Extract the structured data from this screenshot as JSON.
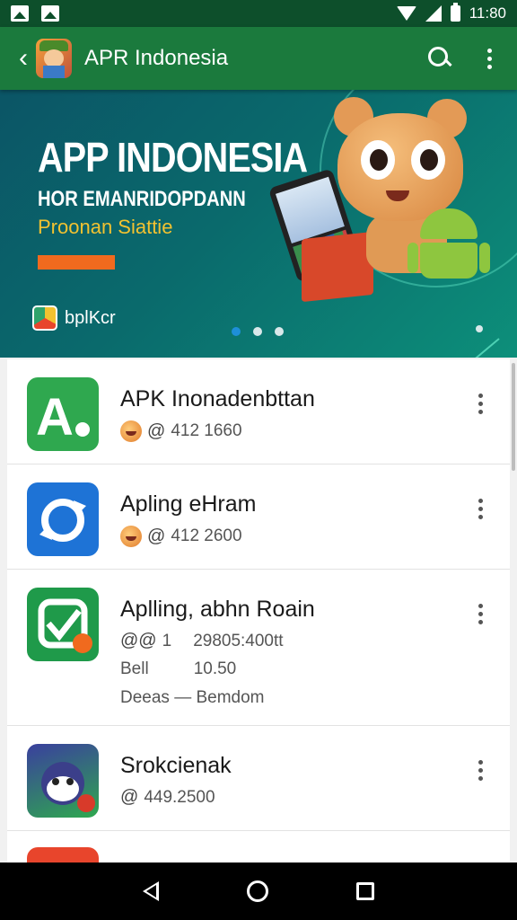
{
  "status_bar": {
    "time": "11:80"
  },
  "toolbar": {
    "title": "APR Indonesia",
    "icons": [
      "back-arrow-icon",
      "app-logo",
      "search-icon",
      "overflow-menu-icon"
    ]
  },
  "banner": {
    "headline": "APP INDONESIA",
    "subheadline": "HOR EMANRIDOPDANN",
    "tagline": "Proonan Siattie",
    "brand": "bplKcr",
    "accent_color": "#f06a1e",
    "page_count": 3,
    "active_page": 1
  },
  "apps": [
    {
      "name": "APK Inonadenbttan",
      "meta": "412 1660",
      "icon": "app-letter-a-icon",
      "icon_bg": "#2fa84f"
    },
    {
      "name": "Apling eHram",
      "meta": "412 2600",
      "icon": "app-sync-icon",
      "icon_bg": "#1e73d6"
    },
    {
      "name": "Aplling, abhn Roain",
      "meta": "29805:400tt",
      "meta_prefix": "1",
      "line2_label": "Bell",
      "line2_value": "10.50",
      "line3": "Deeas — Bemdom",
      "icon": "app-check-icon",
      "icon_bg": "#1f9a4a"
    },
    {
      "name": "Srokcienak",
      "meta": "449.2500",
      "icon": "app-mascot-icon",
      "icon_bg": "#3a3f9e"
    }
  ],
  "colors": {
    "status_bar": "#0d4f2b",
    "toolbar": "#1b7a3d",
    "banner_text": "#ffffff",
    "tagline": "#f2c230"
  }
}
